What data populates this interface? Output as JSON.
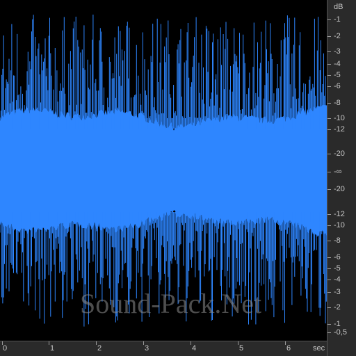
{
  "watermark": "Sound-Pack.Net",
  "db_scale": {
    "unit": "dB",
    "labels": [
      "-1",
      "-2",
      "-3",
      "-4",
      "-5",
      "-6",
      "-8",
      "-10",
      "-12",
      "-20",
      "-∞",
      "-20",
      "-12",
      "-10",
      "-8",
      "-6",
      "-5",
      "-4",
      "-3",
      "-2",
      "-1",
      "-0,5"
    ]
  },
  "time_axis": {
    "unit": "sec",
    "labels": [
      "0",
      "1",
      "2",
      "3",
      "4",
      "5",
      "6"
    ]
  },
  "colors": {
    "background": "#000000",
    "waveform": "#2e86ff",
    "panel": "#2a2a2a",
    "label": "#c8c8c8"
  }
}
